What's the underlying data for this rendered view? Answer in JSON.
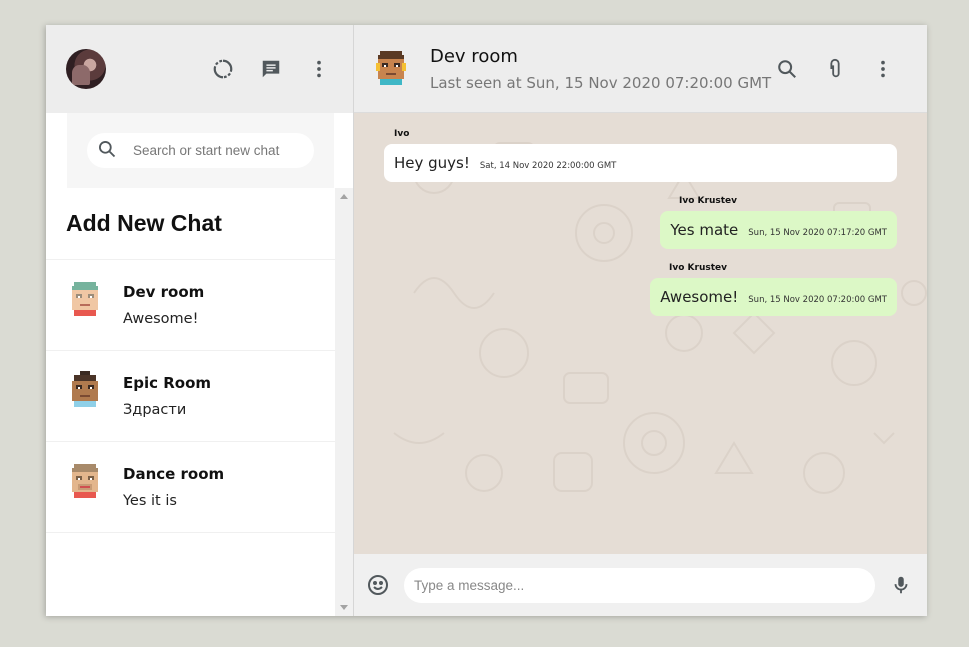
{
  "sidebar": {
    "search": {
      "placeholder": "Search or start new chat"
    },
    "add_new_chat": "Add New Chat",
    "chats": [
      {
        "name": "Dev room",
        "last_message": "Awesome!",
        "avatar": "pixel-avatar-green-hair"
      },
      {
        "name": "Epic Room",
        "last_message": "Здрасти",
        "avatar": "pixel-avatar-dark-skin"
      },
      {
        "name": "Dance room",
        "last_message": "Yes it is",
        "avatar": "pixel-avatar-tan"
      }
    ],
    "icons": [
      "status-icon",
      "new-chat-icon",
      "more-vert-icon"
    ]
  },
  "chat": {
    "room_name": "Dev room",
    "last_seen": "Last seen at Sun, 15 Nov 2020 07:20:00 GMT",
    "messages": [
      {
        "sender": "Ivo",
        "text": "Hey guys!",
        "timestamp": "Sat, 14 Nov 2020 22:00:00 GMT",
        "direction": "in"
      },
      {
        "sender": "Ivo Krustev",
        "text": "Yes mate",
        "timestamp": "Sun, 15 Nov 2020 07:17:20 GMT",
        "direction": "out"
      },
      {
        "sender": "Ivo Krustev",
        "text": "Awesome!",
        "timestamp": "Sun, 15 Nov 2020 07:20:00 GMT",
        "direction": "out"
      }
    ],
    "footer": {
      "placeholder": "Type a message..."
    },
    "icons": [
      "search-icon",
      "attach-icon",
      "more-vert-icon",
      "emoji-icon",
      "mic-icon"
    ]
  },
  "colors": {
    "background": "#dadbd3",
    "panel": "#ededed",
    "chat_bg": "#e5ddd5",
    "outgoing_bubble": "#dcf8c6",
    "incoming_bubble": "#ffffff",
    "icon": "#51585c"
  }
}
